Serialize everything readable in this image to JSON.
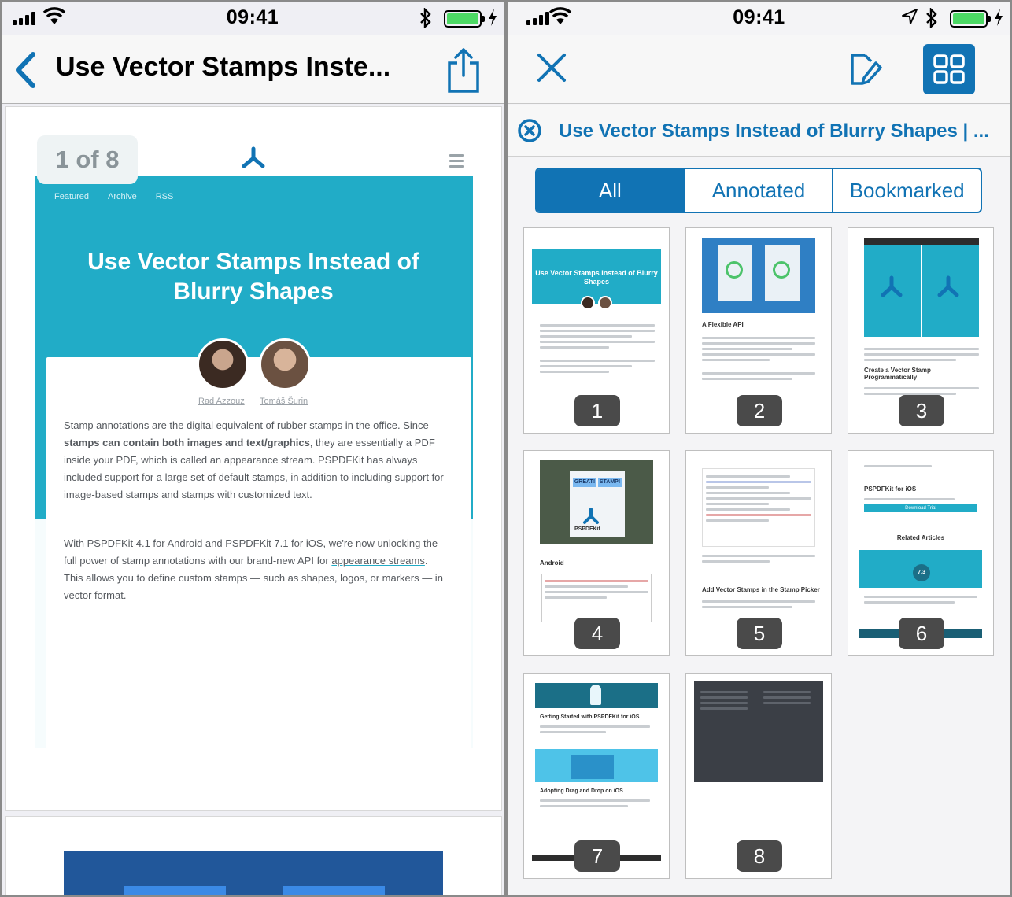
{
  "status_bar": {
    "time": "09:41"
  },
  "left_screen": {
    "nav_title": "Use Vector Stamps Inste...",
    "page_indicator": "1 of 8",
    "page": {
      "links": [
        "Featured",
        "Archive",
        "RSS"
      ],
      "title": "Use Vector Stamps Instead of Blurry Shapes",
      "authors": [
        "Rad Azzouz",
        "Tomáš Šurin"
      ],
      "para1": {
        "a": "Stamp annotations are the digital equivalent of rubber stamps in the office. Since ",
        "b": "stamps can contain both images and text/graphics",
        "c": ", they are essentially a PDF inside your PDF, which is called an appearance stream. PSPDFKit has always included support for ",
        "d": "a large set of default stamps",
        "e": ", in addition to including support for image-based stamps and stamps with customized text."
      },
      "para2": {
        "a": "With ",
        "b": "PSPDFKit 4.1 for Android",
        "c": " and ",
        "d": "PSPDFKit 7.1 for iOS",
        "e": ", we're now unlocking the full power of stamp annotations with our brand-new API for ",
        "f": "appearance streams",
        "g": ". This allows you to define custom stamps — such as shapes, logos, or markers — in vector format."
      }
    }
  },
  "right_screen": {
    "search_title": "Use Vector Stamps Instead of Blurry Shapes | ...",
    "segments": [
      "All",
      "Annotated",
      "Bookmarked"
    ],
    "active_segment": "All",
    "thumbnails": [
      {
        "number": "1",
        "title": "Use Vector Stamps Instead of Blurry Shapes"
      },
      {
        "number": "2",
        "heading": "A Flexible API"
      },
      {
        "number": "3",
        "heading": "Create a Vector Stamp Programmatically"
      },
      {
        "number": "4",
        "heading": "Android",
        "stamp1": "GREAT!",
        "stamp2": "STAMP!",
        "brand": "PSPDFKit"
      },
      {
        "number": "5",
        "heading": "Add Vector Stamps in the Stamp Picker"
      },
      {
        "number": "6",
        "heading": "PSPDFKit for iOS",
        "button": "Download Trial",
        "related": "Related Articles",
        "version": "7.3"
      },
      {
        "number": "7",
        "heading": "Getting Started with PSPDFKit for iOS",
        "heading2": "Adopting Drag and Drop on iOS"
      },
      {
        "number": "8"
      }
    ]
  },
  "colors": {
    "ios_blue": "#1173b4",
    "pspdfkit_teal": "#21acc7",
    "badge_gray": "#4a4a4a",
    "battery_green": "#4cd964"
  }
}
